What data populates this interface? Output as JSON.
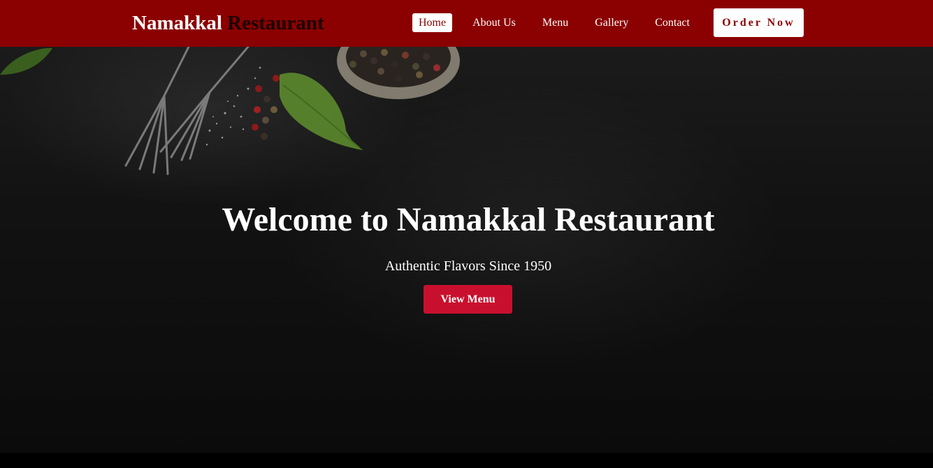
{
  "navbar": {
    "brand_first": "Namakkal",
    "brand_second": "Restaurant",
    "links": [
      {
        "label": "Home",
        "active": true
      },
      {
        "label": "About Us"
      },
      {
        "label": "Menu"
      },
      {
        "label": "Gallery"
      },
      {
        "label": "Contact"
      }
    ],
    "order_button": "Order Now"
  },
  "hero": {
    "title": "Welcome to Namakkal Restaurant",
    "subtitle": "Authentic Flavors Since 1950",
    "cta": "View Menu"
  },
  "colors": {
    "navbar_bg": "#8b0000",
    "cta_bg": "#c8102e",
    "hero_bg": "#121212"
  }
}
